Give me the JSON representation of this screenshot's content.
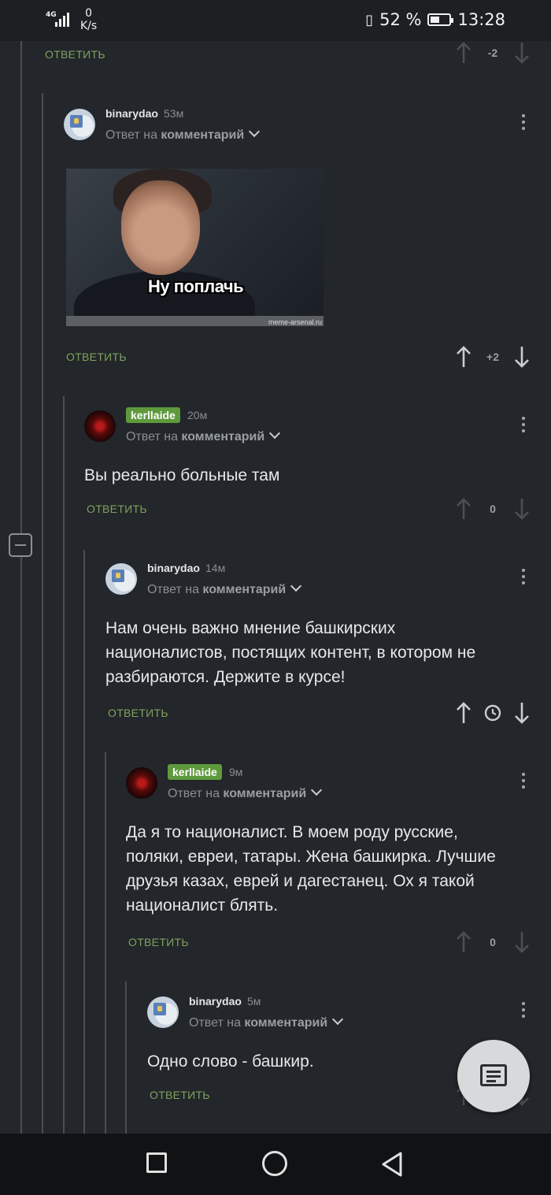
{
  "status_bar": {
    "network": "4G",
    "speed_value": "0",
    "speed_unit": "K/s",
    "battery": "52 %",
    "battery_level": 0.52,
    "time": "13:28"
  },
  "labels": {
    "reply": "ОТВЕТИТЬ",
    "answer_prefix": "Ответ на",
    "answer_target": "комментарий"
  },
  "colors": {
    "background": "#23262a",
    "reply_green": "#7fa35f",
    "badge_green": "#5e9a3c"
  },
  "top_comment": {
    "score": "-2"
  },
  "comments": [
    {
      "author": "binarydao",
      "time": "53м",
      "image_caption": "Ну поплачь",
      "image_watermark": "meme-arsenal.ru",
      "score": "+2"
    },
    {
      "author": "kerllaide",
      "time": "20м",
      "text": "Вы реально больные там",
      "score": "0"
    },
    {
      "author": "binarydao",
      "time": "14м",
      "text": "Нам очень важно мнение башкирских националистов, постящих контент, в котором не разбираются. Держите в курсе!",
      "score_icon": "clock-icon"
    },
    {
      "author": "kerllaide",
      "time": "9м",
      "text": "Да я то националист. В моем роду русские, поляки, евреи, татары. Жена башкирка. Лучшие друзья казах, еврей и дагестанец. Ох я такой националист блять.",
      "score": "0"
    },
    {
      "author": "binarydao",
      "time": "5м",
      "text": "Одно слово - башкир."
    }
  ],
  "icons": {
    "upvote": "arrow-up-icon",
    "downvote": "arrow-down-icon",
    "more": "more-vertical-icon",
    "collapse": "collapse-minus-icon",
    "fab": "comment-icon",
    "nav_recents": "square-icon",
    "nav_home": "circle-icon",
    "nav_back": "triangle-back-icon"
  }
}
